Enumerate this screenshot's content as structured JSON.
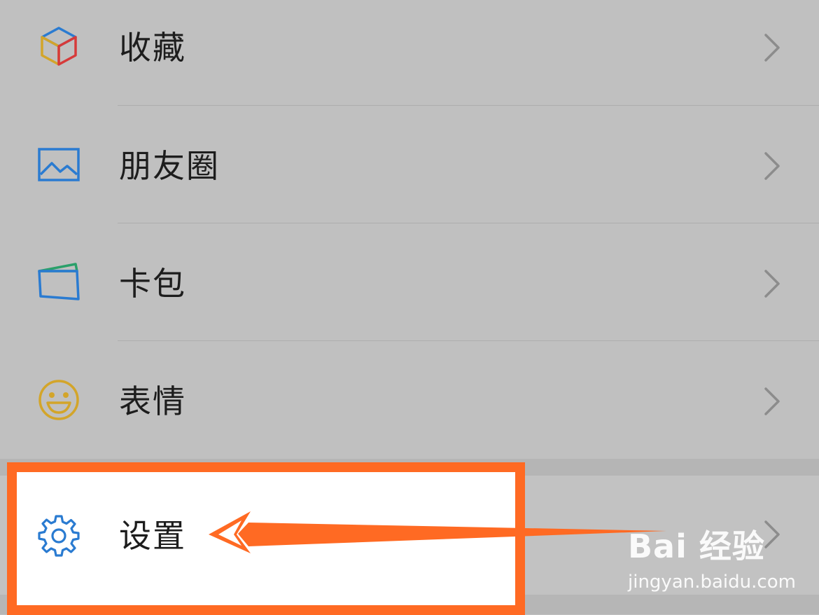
{
  "menu": {
    "items": [
      {
        "label": "收藏",
        "icon": "favorites-cube-icon"
      },
      {
        "label": "朋友圈",
        "icon": "moments-photo-icon"
      },
      {
        "label": "卡包",
        "icon": "card-wallet-icon"
      },
      {
        "label": "表情",
        "icon": "sticker-smile-icon"
      }
    ],
    "settings": {
      "label": "设置",
      "icon": "gear-icon"
    }
  },
  "watermark": {
    "logo": "Bai 经验",
    "url": "jingyan.baidu.com"
  },
  "colors": {
    "background": "#c0c0c0",
    "highlight": "#ff6a23",
    "text": "#1d1d1d",
    "icon_blue": "#2a7bd1",
    "icon_yellow": "#d3a52a"
  }
}
